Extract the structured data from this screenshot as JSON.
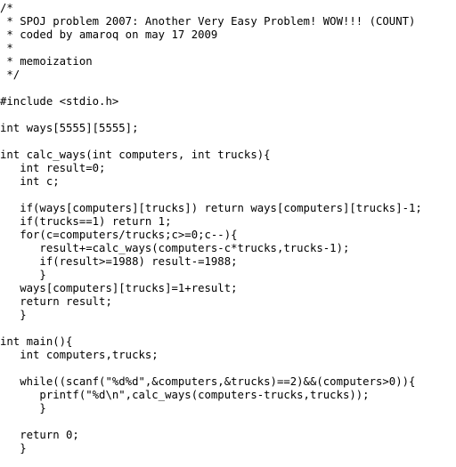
{
  "code": {
    "lines": [
      "/*",
      " * SPOJ problem 2007: Another Very Easy Problem! WOW!!! (COUNT)",
      " * coded by amaroq on may 17 2009",
      " *",
      " * memoization",
      " */",
      "",
      "#include <stdio.h>",
      "",
      "int ways[5555][5555];",
      "",
      "int calc_ways(int computers, int trucks){",
      "   int result=0;",
      "   int c;",
      "",
      "   if(ways[computers][trucks]) return ways[computers][trucks]-1;",
      "   if(trucks==1) return 1;",
      "   for(c=computers/trucks;c>=0;c--){",
      "      result+=calc_ways(computers-c*trucks,trucks-1);",
      "      if(result>=1988) result-=1988;",
      "      }",
      "   ways[computers][trucks]=1+result;",
      "   return result;",
      "   }",
      "",
      "int main(){",
      "   int computers,trucks;",
      "",
      "   while((scanf(\"%d%d\",&computers,&trucks)==2)&&(computers>0)){",
      "      printf(\"%d\\n\",calc_ways(computers-trucks,trucks));",
      "      }",
      "",
      "   return 0;",
      "   }"
    ]
  }
}
